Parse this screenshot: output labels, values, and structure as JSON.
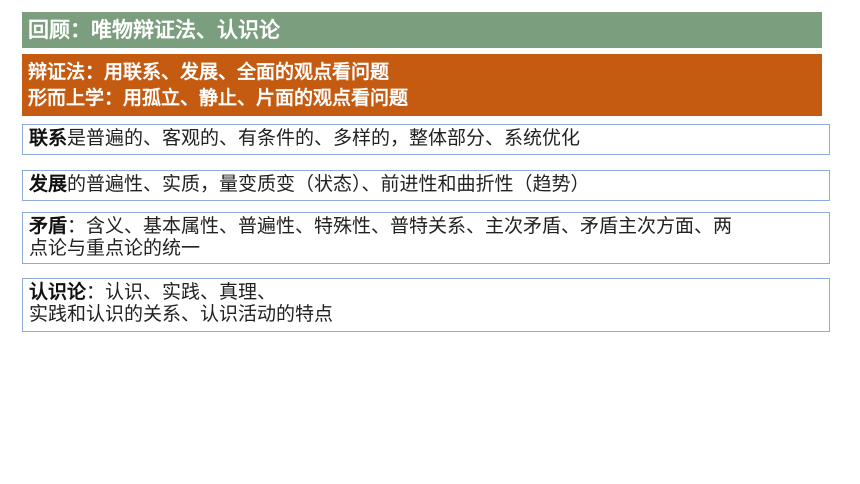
{
  "header": {
    "title": "回顾：唯物辩证法、认识论"
  },
  "method_banner": {
    "line1": "辩证法：用联系、发展、全面的观点看问题",
    "line2": "形而上学：用孤立、静止、片面的观点看问题"
  },
  "boxes": [
    {
      "term": "联系",
      "text": "是普遍的、客观的、有条件的、多样的，整体部分、系统优化"
    },
    {
      "term": "发展",
      "text": "的普遍性、实质，量变质变（状态）、前进性和曲折性（趋势）"
    },
    {
      "term": "矛盾",
      "line1": "：含义、基本属性、普遍性、特殊性、普特关系、主次矛盾、矛盾主次方面、两",
      "line2": "点论与重点论的统一"
    },
    {
      "term": "认识论",
      "line1": "：认识、实践、真理、",
      "line2": "实践和认识的关系、认识活动的特点"
    }
  ],
  "colors": {
    "banner_green": "#7a9e7e",
    "banner_orange": "#c55a11",
    "box_border": "#8eaadb"
  }
}
